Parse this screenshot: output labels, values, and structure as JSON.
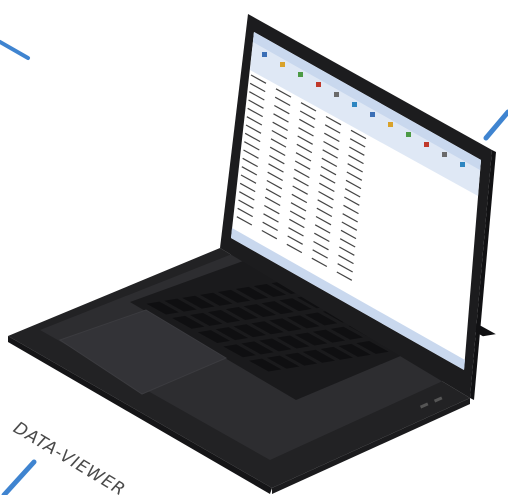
{
  "caption": "DATA-VIEWER",
  "colors": {
    "accent_line": "#3f84d0",
    "laptop_body": "#2b2b2d",
    "screen_bezel": "#1c1c1e",
    "sheet_bg": "#ffffff",
    "ribbon_bg": "#dfe8f5"
  },
  "icons": {
    "laptop": "laptop-icon",
    "spreadsheet": "spreadsheet-app"
  }
}
